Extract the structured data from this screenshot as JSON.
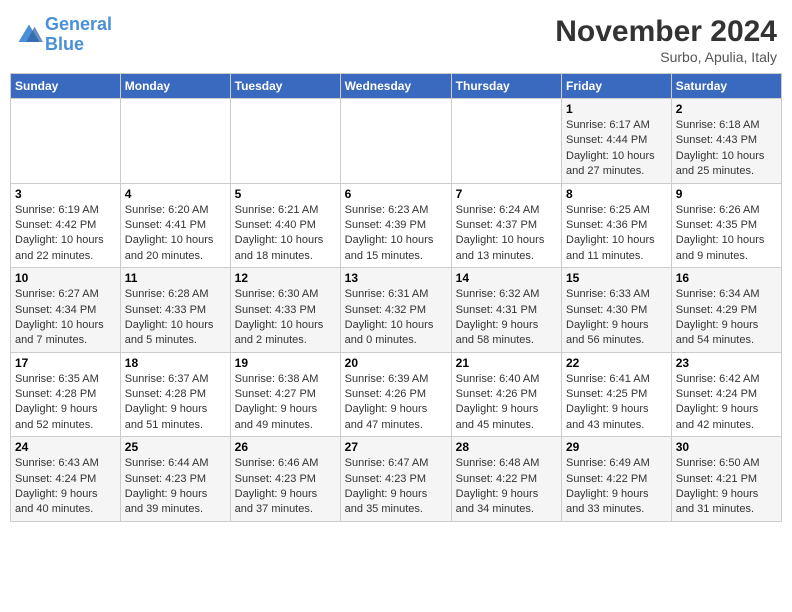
{
  "logo": {
    "line1": "General",
    "line2": "Blue"
  },
  "title": "November 2024",
  "subtitle": "Surbo, Apulia, Italy",
  "days_header": [
    "Sunday",
    "Monday",
    "Tuesday",
    "Wednesday",
    "Thursday",
    "Friday",
    "Saturday"
  ],
  "weeks": [
    [
      {
        "day": "",
        "info": ""
      },
      {
        "day": "",
        "info": ""
      },
      {
        "day": "",
        "info": ""
      },
      {
        "day": "",
        "info": ""
      },
      {
        "day": "",
        "info": ""
      },
      {
        "day": "1",
        "info": "Sunrise: 6:17 AM\nSunset: 4:44 PM\nDaylight: 10 hours and 27 minutes."
      },
      {
        "day": "2",
        "info": "Sunrise: 6:18 AM\nSunset: 4:43 PM\nDaylight: 10 hours and 25 minutes."
      }
    ],
    [
      {
        "day": "3",
        "info": "Sunrise: 6:19 AM\nSunset: 4:42 PM\nDaylight: 10 hours and 22 minutes."
      },
      {
        "day": "4",
        "info": "Sunrise: 6:20 AM\nSunset: 4:41 PM\nDaylight: 10 hours and 20 minutes."
      },
      {
        "day": "5",
        "info": "Sunrise: 6:21 AM\nSunset: 4:40 PM\nDaylight: 10 hours and 18 minutes."
      },
      {
        "day": "6",
        "info": "Sunrise: 6:23 AM\nSunset: 4:39 PM\nDaylight: 10 hours and 15 minutes."
      },
      {
        "day": "7",
        "info": "Sunrise: 6:24 AM\nSunset: 4:37 PM\nDaylight: 10 hours and 13 minutes."
      },
      {
        "day": "8",
        "info": "Sunrise: 6:25 AM\nSunset: 4:36 PM\nDaylight: 10 hours and 11 minutes."
      },
      {
        "day": "9",
        "info": "Sunrise: 6:26 AM\nSunset: 4:35 PM\nDaylight: 10 hours and 9 minutes."
      }
    ],
    [
      {
        "day": "10",
        "info": "Sunrise: 6:27 AM\nSunset: 4:34 PM\nDaylight: 10 hours and 7 minutes."
      },
      {
        "day": "11",
        "info": "Sunrise: 6:28 AM\nSunset: 4:33 PM\nDaylight: 10 hours and 5 minutes."
      },
      {
        "day": "12",
        "info": "Sunrise: 6:30 AM\nSunset: 4:33 PM\nDaylight: 10 hours and 2 minutes."
      },
      {
        "day": "13",
        "info": "Sunrise: 6:31 AM\nSunset: 4:32 PM\nDaylight: 10 hours and 0 minutes."
      },
      {
        "day": "14",
        "info": "Sunrise: 6:32 AM\nSunset: 4:31 PM\nDaylight: 9 hours and 58 minutes."
      },
      {
        "day": "15",
        "info": "Sunrise: 6:33 AM\nSunset: 4:30 PM\nDaylight: 9 hours and 56 minutes."
      },
      {
        "day": "16",
        "info": "Sunrise: 6:34 AM\nSunset: 4:29 PM\nDaylight: 9 hours and 54 minutes."
      }
    ],
    [
      {
        "day": "17",
        "info": "Sunrise: 6:35 AM\nSunset: 4:28 PM\nDaylight: 9 hours and 52 minutes."
      },
      {
        "day": "18",
        "info": "Sunrise: 6:37 AM\nSunset: 4:28 PM\nDaylight: 9 hours and 51 minutes."
      },
      {
        "day": "19",
        "info": "Sunrise: 6:38 AM\nSunset: 4:27 PM\nDaylight: 9 hours and 49 minutes."
      },
      {
        "day": "20",
        "info": "Sunrise: 6:39 AM\nSunset: 4:26 PM\nDaylight: 9 hours and 47 minutes."
      },
      {
        "day": "21",
        "info": "Sunrise: 6:40 AM\nSunset: 4:26 PM\nDaylight: 9 hours and 45 minutes."
      },
      {
        "day": "22",
        "info": "Sunrise: 6:41 AM\nSunset: 4:25 PM\nDaylight: 9 hours and 43 minutes."
      },
      {
        "day": "23",
        "info": "Sunrise: 6:42 AM\nSunset: 4:24 PM\nDaylight: 9 hours and 42 minutes."
      }
    ],
    [
      {
        "day": "24",
        "info": "Sunrise: 6:43 AM\nSunset: 4:24 PM\nDaylight: 9 hours and 40 minutes."
      },
      {
        "day": "25",
        "info": "Sunrise: 6:44 AM\nSunset: 4:23 PM\nDaylight: 9 hours and 39 minutes."
      },
      {
        "day": "26",
        "info": "Sunrise: 6:46 AM\nSunset: 4:23 PM\nDaylight: 9 hours and 37 minutes."
      },
      {
        "day": "27",
        "info": "Sunrise: 6:47 AM\nSunset: 4:23 PM\nDaylight: 9 hours and 35 minutes."
      },
      {
        "day": "28",
        "info": "Sunrise: 6:48 AM\nSunset: 4:22 PM\nDaylight: 9 hours and 34 minutes."
      },
      {
        "day": "29",
        "info": "Sunrise: 6:49 AM\nSunset: 4:22 PM\nDaylight: 9 hours and 33 minutes."
      },
      {
        "day": "30",
        "info": "Sunrise: 6:50 AM\nSunset: 4:21 PM\nDaylight: 9 hours and 31 minutes."
      }
    ]
  ]
}
